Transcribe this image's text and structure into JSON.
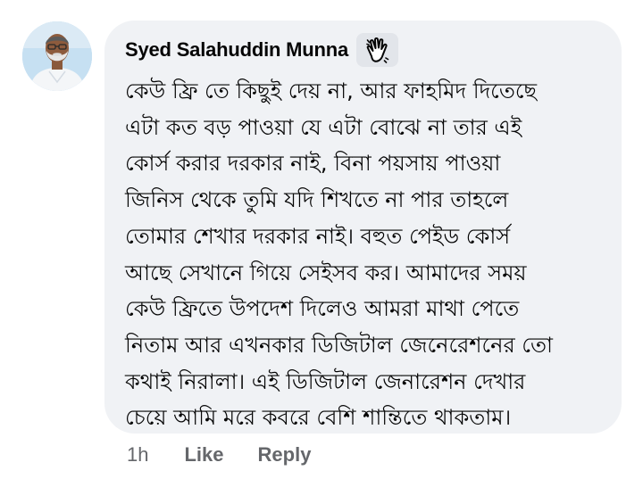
{
  "comment": {
    "author": "Syed Salahuddin Munna",
    "badge_icon": "waving-hand-icon",
    "avatar_icon": "profile-photo",
    "lines": [
      "কেউ ফ্রি তে কিছুই দেয় না, আর ফাহমিদ দিতেছে",
      "এটা কত বড় পাওয়া যে এটা বোঝে না তার এই",
      "কোর্স করার দরকার নাই, বিনা পয়সায় পাওয়া",
      "জিনিস থেকে তুমি যদি শিখতে না পার তাহলে",
      "তোমার শেখার দরকার নাই। বহুত পেইড কোর্স",
      "আছে সেখানে গিয়ে সেইসব কর। আমাদের সময়",
      "কেউ ফ্রিতে উপদেশ দিলেও আমরা মাথা পেতে",
      "নিতাম আর এখনকার ডিজিটাল জেনেরেশনের তো",
      "কথাই নিরালা। এই ডিজিটাল জেনারেশন দেখার",
      "চেয়ে আমি মরে কবরে বেশি শান্তিতে থাকতাম।"
    ]
  },
  "actions": {
    "time": "1h",
    "like": "Like",
    "reply": "Reply"
  },
  "colors": {
    "bubble": "#f0f2f5",
    "text": "#050505",
    "meta": "#65676b",
    "badge_bg": "#e2e5ea"
  }
}
